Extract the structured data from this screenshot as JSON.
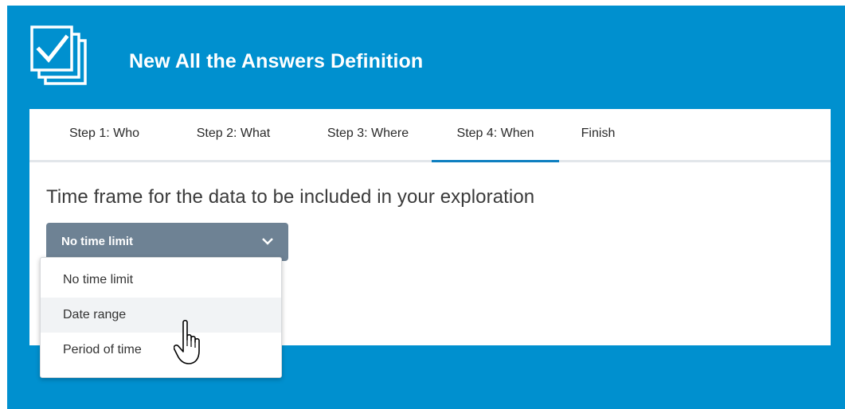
{
  "header": {
    "title": "New All the Answers Definition",
    "icon": "stacked-checkbox-icon"
  },
  "tabs": [
    {
      "label": "Step 1: Who",
      "active": false
    },
    {
      "label": "Step 2: What",
      "active": false
    },
    {
      "label": "Step 3: Where",
      "active": false
    },
    {
      "label": "Step 4: When",
      "active": true
    },
    {
      "label": "Finish",
      "active": false
    }
  ],
  "timeframe": {
    "heading": "Time frame for the data to be included in your exploration",
    "selected": "No time limit",
    "options": [
      "No time limit",
      "Date range",
      "Period of time"
    ],
    "hovered_option": "Date range"
  },
  "colors": {
    "header_bg": "#0090cf",
    "select_bg": "#6e8294",
    "active_tab_underline": "#0e7fc0",
    "hover_bg": "#f1f3f5"
  }
}
